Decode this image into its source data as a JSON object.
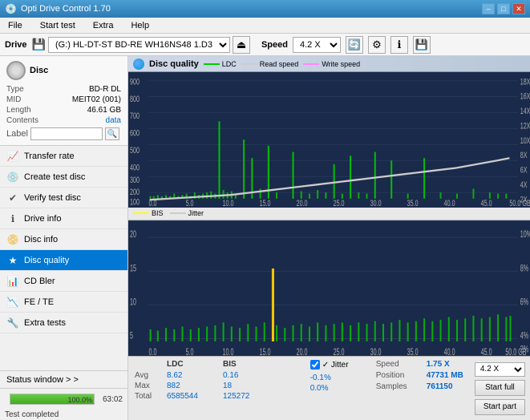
{
  "titleBar": {
    "title": "Opti Drive Control 1.70",
    "minimize": "–",
    "maximize": "□",
    "close": "✕"
  },
  "menuBar": {
    "items": [
      "File",
      "Start test",
      "Extra",
      "Help"
    ]
  },
  "driveToolbar": {
    "driveLabel": "Drive",
    "driveValue": "(G:)  HL-DT-ST BD-RE  WH16NS48 1.D3",
    "speedLabel": "Speed",
    "speedValue": "4.2 X"
  },
  "disc": {
    "title": "Disc",
    "typeLabel": "Type",
    "typeValue": "BD-R DL",
    "midLabel": "MID",
    "midValue": "MEIT02 (001)",
    "lengthLabel": "Length",
    "lengthValue": "46.61 GB",
    "contentsLabel": "Contents",
    "contentsValue": "data",
    "labelLabel": "Label",
    "labelValue": ""
  },
  "navItems": [
    {
      "id": "transfer-rate",
      "label": "Transfer rate",
      "icon": "📈"
    },
    {
      "id": "create-test-disc",
      "label": "Create test disc",
      "icon": "💿"
    },
    {
      "id": "verify-test-disc",
      "label": "Verify test disc",
      "icon": "✔"
    },
    {
      "id": "drive-info",
      "label": "Drive info",
      "icon": "ℹ"
    },
    {
      "id": "disc-info",
      "label": "Disc info",
      "icon": "📀"
    },
    {
      "id": "disc-quality",
      "label": "Disc quality",
      "icon": "★",
      "active": true
    },
    {
      "id": "cd-bler",
      "label": "CD Bler",
      "icon": "📊"
    },
    {
      "id": "fe-te",
      "label": "FE / TE",
      "icon": "📉"
    },
    {
      "id": "extra-tests",
      "label": "Extra tests",
      "icon": "🔧"
    }
  ],
  "statusWindow": {
    "label": "Status window > >",
    "progressPercent": 100,
    "progressText": "100.0%",
    "statusText": "Test completed",
    "rightValue": "63:02"
  },
  "chartArea": {
    "title": "Disc quality",
    "legend": [
      {
        "label": "LDC",
        "color": "#00cc00"
      },
      {
        "label": "Read speed",
        "color": "#ffffff"
      },
      {
        "label": "Write speed",
        "color": "#ff88ff"
      }
    ],
    "legend2": [
      {
        "label": "BIS",
        "color": "#ffff00"
      },
      {
        "label": "Jitter",
        "color": "#ffffff"
      }
    ]
  },
  "stats": {
    "columns": [
      "LDC",
      "BIS"
    ],
    "rows": [
      {
        "label": "Avg",
        "ldc": "8.62",
        "bis": "0.16",
        "jitter": "-0.1%"
      },
      {
        "label": "Max",
        "ldc": "882",
        "bis": "18",
        "jitter": "0.0%"
      },
      {
        "label": "Total",
        "ldc": "6585544",
        "bis": "125272",
        "jitter": ""
      }
    ],
    "jitterLabel": "✓ Jitter",
    "speedLabel": "Speed",
    "speedValue": "1.75 X",
    "positionLabel": "Position",
    "positionValue": "47731 MB",
    "samplesLabel": "Samples",
    "samplesValue": "761150",
    "speedSelectValue": "4.2 X",
    "btnStartFull": "Start full",
    "btnStartPart": "Start part"
  }
}
